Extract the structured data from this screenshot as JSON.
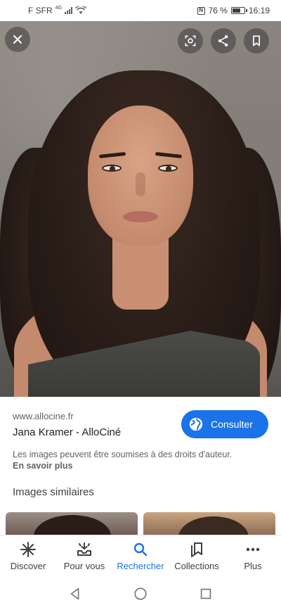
{
  "status_bar": {
    "carrier": "F SFR",
    "network": "4G",
    "battery": "76 %",
    "battery_level": 0.76,
    "time": "16:19"
  },
  "toolbar": {
    "close_icon": "close-icon",
    "lens_icon": "lens-icon",
    "share_icon": "share-icon",
    "bookmark_icon": "bookmark-icon"
  },
  "result": {
    "source": "www.allocine.fr",
    "title": "Jana Kramer - AlloCiné",
    "consult_label": "Consulter",
    "copyright": "Les images peuvent être soumises à des droits d'auteur.",
    "learn_more": "En savoir plus"
  },
  "similar": {
    "title": "Images similaires"
  },
  "bottom_nav": {
    "items": [
      {
        "label": "Discover",
        "icon": "asterisk-icon"
      },
      {
        "label": "Pour vous",
        "icon": "inbox-icon"
      },
      {
        "label": "Rechercher",
        "icon": "search-icon"
      },
      {
        "label": "Collections",
        "icon": "collections-icon"
      },
      {
        "label": "Plus",
        "icon": "more-icon"
      }
    ]
  },
  "colors": {
    "accent": "#1a73e8",
    "text": "#202124",
    "secondary": "#5f6368"
  }
}
